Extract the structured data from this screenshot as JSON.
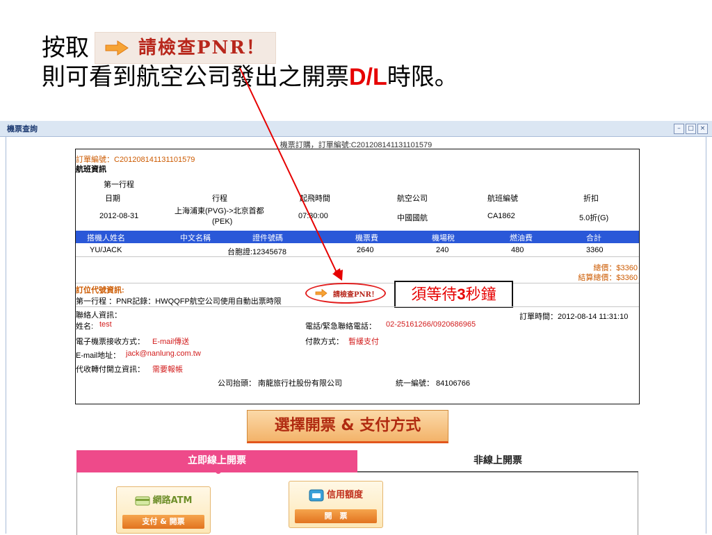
{
  "slide": {
    "line1_prefix": "按取",
    "line2_prefix": "則可看到航空公司發出之開票",
    "line2_highlight": "D/L",
    "line2_suffix": "時限。",
    "pnr_badge_label": "請檢查PNR！"
  },
  "window": {
    "title": "機票查詢",
    "buttons": [
      "–",
      "□",
      "×"
    ]
  },
  "order": {
    "heading": "機票訂購，訂單編號:C201208141131101579",
    "number_line": "訂單編號：C201208141131101579",
    "flight_info_title": "航班資訊",
    "segment_label": "第一行程",
    "flight_headers": [
      "日期",
      "行程",
      "起飛時間",
      "航空公司",
      "航班編號",
      "折扣"
    ],
    "flight_row": {
      "date": "2012-08-31",
      "route_line1": "上海浦東(PVG)->北京首都",
      "route_line2": "(PEK)",
      "depart": "07:30:00",
      "airline": "中國國航",
      "flight_no": "CA1862",
      "discount": "5.0折(G)"
    },
    "pax_headers": [
      "搭機人姓名",
      "中文名稱",
      "證件號碼",
      "機票費",
      "機場稅",
      "燃油費",
      "合計"
    ],
    "pax_row": {
      "name": "YU/JACK",
      "cn_name": "",
      "id_no": "台胞證:12345678",
      "fare": "2640",
      "airport_tax": "240",
      "fuel": "480",
      "total": "3360"
    },
    "total_price": "總價：$3360",
    "settle_price": "結算總價：$3360",
    "pnr_section_title": "訂位代號資訊:",
    "pnr_line": "第一行程 ：PNR記錄：HWQQFP航空公司使用自動出票時限",
    "contact_label": "聯絡人資訊：",
    "order_time": "訂單時間：2012-08-14 11:31:10",
    "name_label": "姓名:",
    "name_value": "test",
    "phone_label": "電話/緊急聯絡電話：",
    "phone_value": "02-25161266/0920686965",
    "eticket_label": "電子機票接收方式：",
    "eticket_value": "E-mail傳送",
    "pay_label": "付款方式：",
    "pay_value": "暫緩支付",
    "email_label": "E-mail地址：",
    "email_value": "jack@nanlung.com.tw",
    "collect_label": "代收轉付開立資訊：",
    "collect_value": "需要報帳",
    "company_line": "公司抬頭： 南龍旅行社股份有限公司",
    "tax_id_line": "統一編號： 84106766",
    "pnr_button_label": "請檢查PNR！",
    "wait_note_pre": "須等待",
    "wait_note_num": "3",
    "wait_note_post": "秒鐘"
  },
  "payment": {
    "choose_label": "選擇開票 & 支付方式",
    "tab_online": "立即線上開票",
    "tab_offline": "非線上開票",
    "atm_top": "網路ATM",
    "atm_bottom": "支付 & 開票",
    "credit_top": "信用額度",
    "credit_bottom": "開　票"
  },
  "colors": {
    "accent_red": "#e60000",
    "header_blue": "#2a58d8",
    "tab_pink": "#ee4a8a",
    "order_orange": "#cc5a00"
  }
}
